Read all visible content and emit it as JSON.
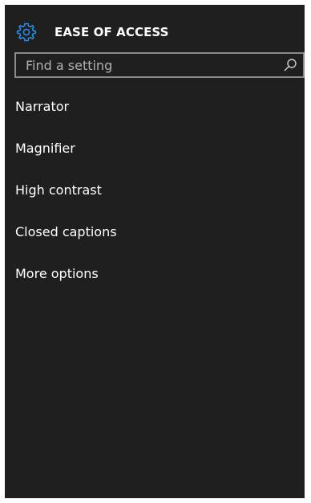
{
  "header": {
    "title": "EASE OF ACCESS",
    "icon": "gear-icon",
    "accent_color": "#2b8ae2"
  },
  "search": {
    "placeholder": "Find a setting",
    "value": "",
    "icon": "search-icon"
  },
  "menu": {
    "items": [
      {
        "label": "Narrator"
      },
      {
        "label": "Magnifier"
      },
      {
        "label": "High contrast"
      },
      {
        "label": "Closed captions"
      },
      {
        "label": "More options"
      }
    ]
  },
  "colors": {
    "background": "#1f1f1f",
    "text": "#ffffff",
    "search_border": "#8a8a8a"
  }
}
